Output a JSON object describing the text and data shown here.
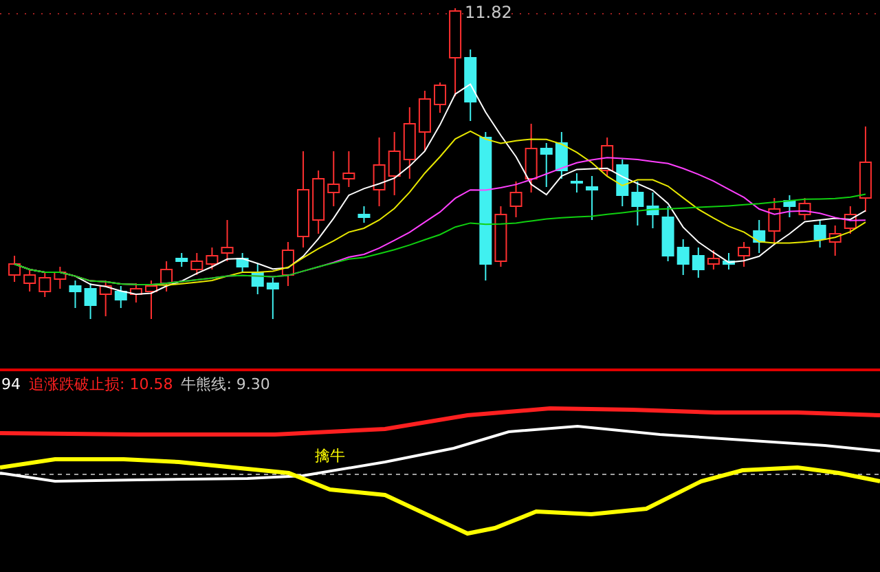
{
  "price_pane": {
    "high_label": "11.82"
  },
  "indicator_pane": {
    "legend": [
      {
        "kind": "index",
        "text": "94"
      },
      {
        "kind": "stop",
        "text": "追涨跌破止损: 10.58"
      },
      {
        "kind": "line",
        "text": "牛熊线: 9.30"
      }
    ],
    "signal_label": "擒牛"
  }
}
